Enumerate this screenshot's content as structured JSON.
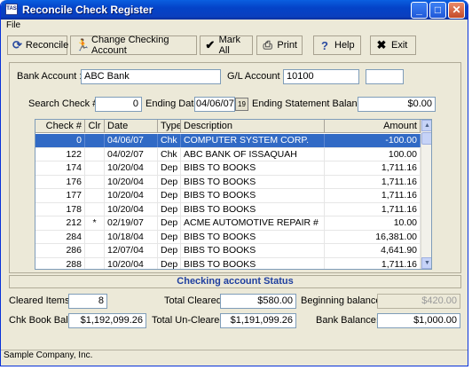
{
  "window": {
    "title": "Reconcile Check Register",
    "app_icon_text": "TAS"
  },
  "menu": {
    "file": "File"
  },
  "toolbar": [
    {
      "label": "Reconcile",
      "icon": "refresh-icon"
    },
    {
      "label": "Change Checking Account",
      "icon": "person-icon"
    },
    {
      "label": "Mark All",
      "icon": "checkmark-icon"
    },
    {
      "label": "Print",
      "icon": "printer-icon"
    },
    {
      "label": "Help",
      "icon": "question-icon"
    },
    {
      "label": "Exit",
      "icon": "x-icon"
    }
  ],
  "account": {
    "bank_label": "Bank Account :",
    "bank_value": "ABC Bank",
    "gl_label": "G/L Account :",
    "gl_value": "10100",
    "gl_extra": ""
  },
  "search": {
    "check_label": "Search Check # :",
    "check_value": "0",
    "ending_date_label": "Ending Date:",
    "ending_date_value": "04/06/07",
    "ending_balance_label": "Ending Statement Balance:",
    "ending_balance_value": "$0.00"
  },
  "grid": {
    "headers": [
      "Check #",
      "Clr",
      "Date",
      "Type",
      "Description",
      "Amount"
    ],
    "rows": [
      [
        "0",
        "",
        "04/06/07",
        "Chk",
        "COMPUTER SYSTEM CORP.",
        "-100.00"
      ],
      [
        "122",
        "",
        "04/02/07",
        "Chk",
        "ABC BANK OF ISSAQUAH",
        "100.00"
      ],
      [
        "174",
        "",
        "10/20/04",
        "Dep",
        "BIBS TO BOOKS",
        "1,711.16"
      ],
      [
        "176",
        "",
        "10/20/04",
        "Dep",
        "BIBS TO BOOKS",
        "1,711.16"
      ],
      [
        "177",
        "",
        "10/20/04",
        "Dep",
        "BIBS TO BOOKS",
        "1,711.16"
      ],
      [
        "178",
        "",
        "10/20/04",
        "Dep",
        "BIBS TO BOOKS",
        "1,711.16"
      ],
      [
        "212",
        "*",
        "02/19/07",
        "Dep",
        "ACME AUTOMOTIVE REPAIR #",
        "10.00"
      ],
      [
        "284",
        "",
        "10/18/04",
        "Dep",
        "BIBS TO BOOKS",
        "16,381.00"
      ],
      [
        "286",
        "",
        "12/07/04",
        "Dep",
        "BIBS TO BOOKS",
        "4,641.90"
      ],
      [
        "288",
        "",
        "10/20/04",
        "Dep",
        "BIBS TO BOOKS",
        "1,711.16"
      ]
    ],
    "selected_row": 0
  },
  "status": {
    "title": "Checking account Status",
    "cleared_items_label": "Cleared Items:",
    "cleared_items_value": "8",
    "total_cleared_label": "Total Cleared:",
    "total_cleared_value": "$580.00",
    "beginning_balance_label": "Beginning balance:",
    "beginning_balance_value": "$420.00",
    "chk_book_bal_label": "Chk Book Bal:",
    "chk_book_bal_value": "$1,192,099.26",
    "total_uncleared_label": "Total Un-Cleared:",
    "total_uncleared_value": "$1,191,099.26",
    "bank_balance_label": "Bank Balance:",
    "bank_balance_value": "$1,000.00"
  },
  "statusbar": {
    "text": "Sample Company, Inc."
  },
  "colors": {
    "titlebar": "#0a3fbf",
    "selection": "#316ac5",
    "status_title": "#1f3f9f",
    "face": "#ece9d8"
  }
}
